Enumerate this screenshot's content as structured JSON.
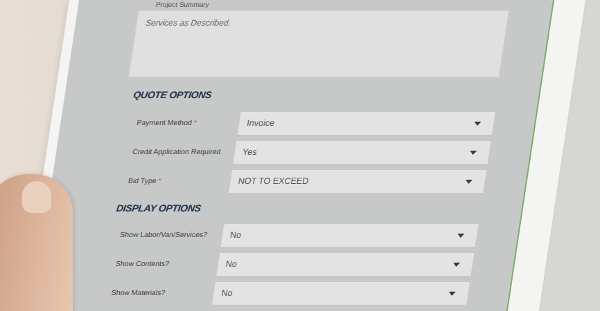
{
  "form": {
    "summary_label": "Project Summary",
    "summary": "Services as Described.",
    "required_mark": "*",
    "sections": [
      {
        "title": "QUOTE OPTIONS",
        "fields": [
          {
            "label": "Payment Method",
            "required": true,
            "value": "Invoice"
          },
          {
            "label": "Credit Application Required",
            "required": false,
            "value": "Yes"
          },
          {
            "label": "Bid Type",
            "required": true,
            "value": "NOT TO EXCEED"
          }
        ]
      },
      {
        "title": "DISPLAY OPTIONS",
        "fields": [
          {
            "label": "Show Labor/Van/Services?",
            "required": false,
            "value": "No"
          },
          {
            "label": "Show Contents?",
            "required": false,
            "value": "No"
          },
          {
            "label": "Show Materials?",
            "required": false,
            "value": "No"
          }
        ]
      }
    ]
  }
}
